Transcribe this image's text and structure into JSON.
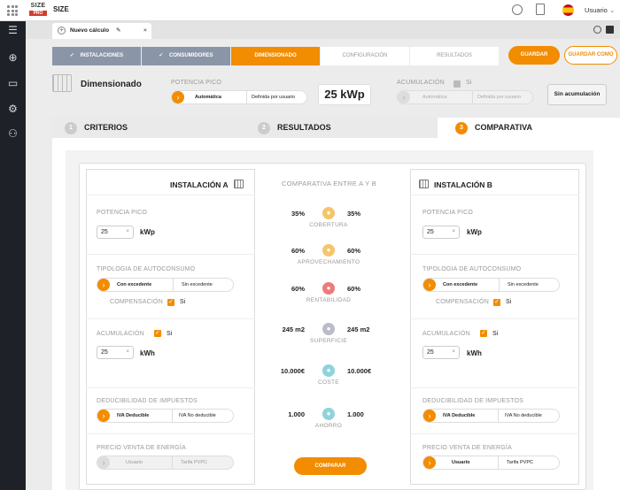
{
  "app": {
    "logo_top": "SIZE",
    "logo_bottom": "PRO",
    "title": "SIZE",
    "user": "Usuario"
  },
  "tab": {
    "label": "Nuevo cálculo"
  },
  "steps": [
    "INSTALACIONES",
    "CONSUMIDORES",
    "DIMENSIONADO",
    "CONFIGURACIÓN",
    "RESULTADOS"
  ],
  "buttons": {
    "guardar": "GUARDAR",
    "guardar_como": "GUARDAR COMO",
    "sin_acumulacion": "Sin acumulación",
    "comparar": "COMPARAR"
  },
  "dim": {
    "title": "Dimensionado",
    "potencia_label": "POTENCIA PICO",
    "seg_a": "Automática",
    "seg_b": "Definida por usuario",
    "value": "25 kWp",
    "acum_label": "ACUMULACIÓN",
    "si": "Si",
    "acum_a": "Automática",
    "acum_b": "Definida por usuario"
  },
  "section_tabs": [
    {
      "n": "1",
      "label": "CRITERIOS"
    },
    {
      "n": "2",
      "label": "RESULTADOS"
    },
    {
      "n": "3",
      "label": "COMPARATIVA"
    }
  ],
  "inst_a": {
    "title": "INSTALACIÓN A"
  },
  "inst_b": {
    "title": "INSTALACIÓN B"
  },
  "fields": {
    "potencia": "POTENCIA PICO",
    "potencia_val": "25",
    "kwp": "kWp",
    "tipologia": "TIPOLOGIA DE AUTOCONSUMO",
    "con_exc": "Con excedente",
    "sin_exc": "Sin excedente",
    "compensacion": "COMPENSACIÓN",
    "si": "Si",
    "acumulacion": "ACUMULACIÓN",
    "acum_val": "25",
    "kwh": "kWh",
    "deducibilidad": "DEDUCIBILIDAD DE IMPUESTOS",
    "iva_ded": "IVA Deducible",
    "iva_no": "IVA No deducible",
    "precio": "PRECIO VENTA DE ENERGÍA",
    "usuario": "Usuario",
    "tarifa": "Tarifa PVPC",
    "x": "×"
  },
  "comparativa": {
    "title": "COMPARATIVA ENTRE A Y B",
    "rows": [
      {
        "a": "35%",
        "b": "35%",
        "label": "COBERTURA",
        "color": "#f5c56b"
      },
      {
        "a": "60%",
        "b": "60%",
        "label": "APROVECHAMIENTO",
        "color": "#f5c56b"
      },
      {
        "a": "60%",
        "b": "60%",
        "label": "RENTABILIDAD",
        "color": "#ef7a7a"
      },
      {
        "a": "245 m2",
        "b": "245 m2",
        "label": "SUPERFICIE",
        "color": "#b9bdc9"
      },
      {
        "a": "10.000€",
        "b": "10.000€",
        "label": "COSTE",
        "color": "#8fd3db"
      },
      {
        "a": "1.000",
        "b": "1.000",
        "label": "AHORRO",
        "color": "#8fd3db"
      }
    ]
  }
}
